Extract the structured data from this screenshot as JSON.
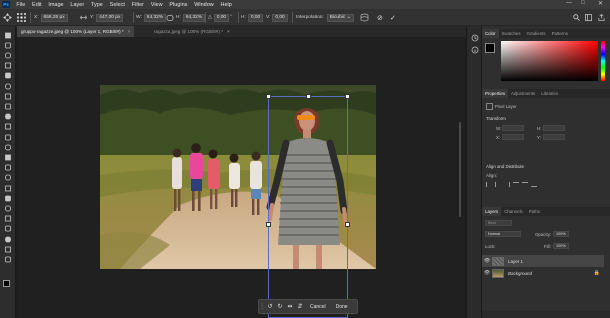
{
  "menu": {
    "logo": "Ps",
    "items": [
      "File",
      "Edit",
      "Image",
      "Layer",
      "Type",
      "Select",
      "Filter",
      "View",
      "Plugins",
      "Window",
      "Help"
    ],
    "window_controls": [
      "—",
      "□",
      "✕"
    ]
  },
  "options_bar": {
    "x_label": "X:",
    "x_value": "656,26 px",
    "y_label": "Y:",
    "y_value": "447,00 px",
    "w_label": "W:",
    "w_value": "64,32%",
    "h_label": "H:",
    "h_value": "64,32%",
    "angle_label": "△",
    "angle_value": "0,00",
    "angle_unit": "°",
    "hskew_label": "H:",
    "hskew_value": "0,00",
    "vskew_label": "V:",
    "vskew_value": "0,00",
    "interp_label": "Interpolation:",
    "interp_value": "Bicubic",
    "cancel_icon": "⊘",
    "commit_icon": "✓"
  },
  "tabs": [
    {
      "label": "gruppo-ragazze.jpeg @ 100% (Layer 1, RGB/8#) *",
      "active": true
    },
    {
      "label": "ragazza.jpeg @ 100% (RGB/8#) *",
      "active": false
    }
  ],
  "taskbar": {
    "cancel": "Cancel",
    "done": "Done",
    "icons": [
      "rotate-left-icon",
      "rotate-right-icon",
      "flip-horizontal-icon",
      "flip-vertical-icon"
    ]
  },
  "color_panel": {
    "tabs": [
      "Color",
      "Swatches",
      "Gradients",
      "Patterns"
    ],
    "hue_color": "#ff0000"
  },
  "properties_panel": {
    "tabs": [
      "Properties",
      "Adjustments",
      "Libraries"
    ],
    "layer_type": "Pixel Layer",
    "transform_label": "Transform",
    "w_label": "W:",
    "h_label": "H:",
    "x_label": "X:",
    "y_label": "Y:",
    "align_label": "Align and Distribute",
    "align_sub": "Align:"
  },
  "layers_panel": {
    "tabs": [
      "Layers",
      "Channels",
      "Paths"
    ],
    "kind_label": "Kind",
    "blend_mode": "Normal",
    "opacity_label": "Opacity:",
    "opacity_value": "100%",
    "lock_label": "Lock:",
    "fill_label": "Fill:",
    "fill_value": "100%",
    "layers": [
      {
        "name": "Layer 1",
        "selected": true
      },
      {
        "name": "Background",
        "selected": false
      }
    ]
  },
  "colors": {
    "accent": "#5a6cc8",
    "panel_bg": "#2f2f2f",
    "canvas_bg": "#202020",
    "menu_bg": "#3b3b3b"
  }
}
